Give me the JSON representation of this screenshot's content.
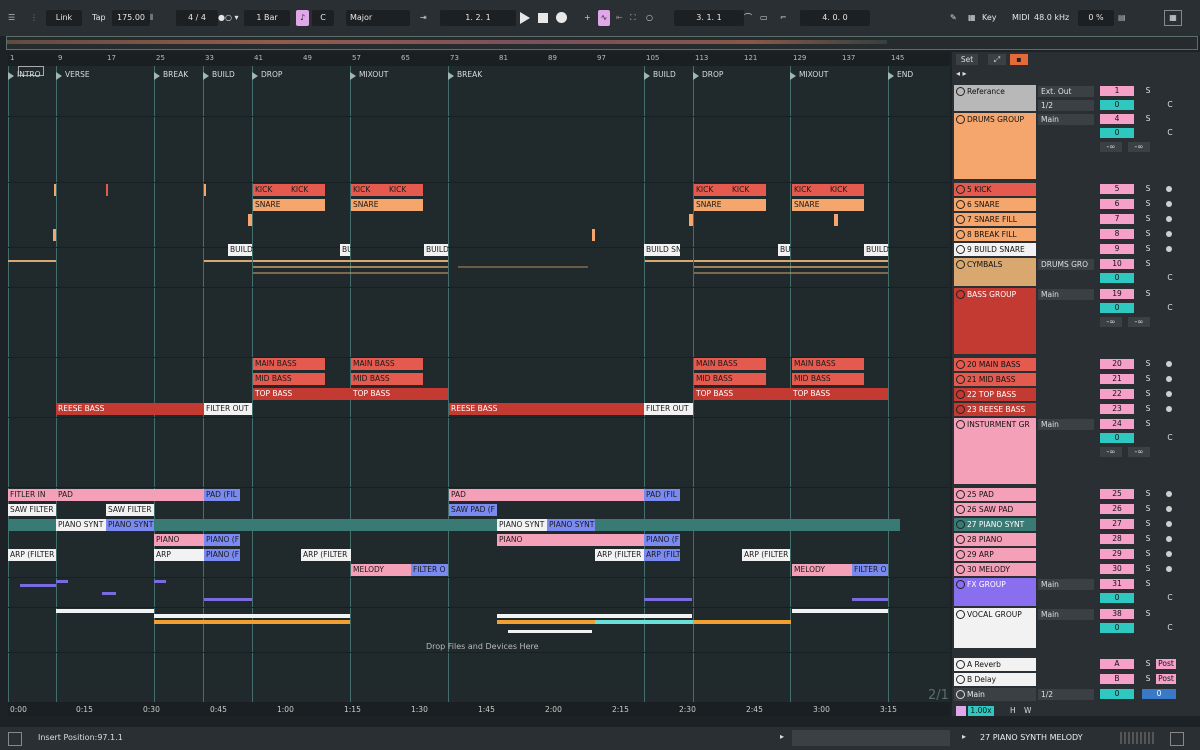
{
  "transport": {
    "link": "Link",
    "tap": "Tap",
    "tempo": "175.00",
    "signature_num": "4",
    "signature_den": "4",
    "quantize": "1 Bar",
    "key": "C",
    "scale": "Major",
    "position": "1.  2.  1",
    "loop_start": "3.  1.  1",
    "loop_length": "4.  0.  0",
    "key_label": "Key",
    "midi_label": "MIDI",
    "sample_rate": "48.0 kHz",
    "cpu": "0 %"
  },
  "locators": [
    "INTRO",
    "VERSE",
    "BREAK",
    "BUILD",
    "DROP",
    "MIXOUT",
    "BREAK",
    "BUILD",
    "DROP",
    "MIXOUT",
    "END"
  ],
  "bar_numbers": [
    "1",
    "9",
    "17",
    "25",
    "33",
    "41",
    "49",
    "57",
    "65",
    "73",
    "81",
    "89",
    "97",
    "105",
    "113",
    "121",
    "129",
    "137",
    "145"
  ],
  "times": [
    "0:00",
    "0:15",
    "0:30",
    "0:45",
    "1:00",
    "1:15",
    "1:30",
    "1:45",
    "2:00",
    "2:15",
    "2:30",
    "2:45",
    "3:00",
    "3:15"
  ],
  "clips": {
    "kick": "KICK",
    "snare": "SNARE",
    "build": "BUILD",
    "build_sn": "BUILD SN",
    "main_bass": "MAIN BASS",
    "mid_bass": "MID BASS",
    "top_bass": "TOP BASS",
    "reese_bass": "REESE BASS",
    "filter_out": "FILTER OUT",
    "filter_in": "FITLER IN",
    "pad": "PAD",
    "pad_fil": "PAD (FIL",
    "saw_filter": "SAW FILTER",
    "saw_pad": "SAW PAD (F",
    "piano_synth": "PIANO SYNT",
    "piano": "PIANO",
    "piano_f": "PIANO (F",
    "arp": "ARP",
    "arp_filter": "ARP (FILTER",
    "melody": "MELODY",
    "filter_o": "FILTER O"
  },
  "drop_hint": "Drop Files and Devices Here",
  "page_indicator": "2/1",
  "set_button": "Set",
  "tracks": [
    {
      "name": "Referance",
      "io": "Ext. Out",
      "io2": "1/2",
      "num": "1",
      "color": "#b8b8b8"
    },
    {
      "name": "DRUMS GROUP",
      "io": "Main",
      "num": "4",
      "color": "#f4a66c"
    },
    {
      "name": "5 KICK",
      "num": "5",
      "color": "#e45a4f"
    },
    {
      "name": "6 SNARE",
      "num": "6",
      "color": "#f4a66c"
    },
    {
      "name": "7 SNARE FILL",
      "num": "7",
      "color": "#f4a66c"
    },
    {
      "name": "8 BREAK FILL",
      "num": "8",
      "color": "#f4a66c"
    },
    {
      "name": "9 BUILD SNARE",
      "num": "9",
      "color": "#f2f2f2"
    },
    {
      "name": "CYMBALS",
      "io": "DRUMS GRO",
      "num": "10",
      "color": "#d8a870"
    },
    {
      "name": "BASS GROUP",
      "io": "Main",
      "num": "19",
      "color": "#c23a32"
    },
    {
      "name": "20 MAIN BASS",
      "num": "20",
      "color": "#e45a4f"
    },
    {
      "name": "21 MID BASS",
      "num": "21",
      "color": "#e45a4f"
    },
    {
      "name": "22 TOP BASS",
      "num": "22",
      "color": "#c23a32"
    },
    {
      "name": "23 REESE BASS",
      "num": "23",
      "color": "#c23a32"
    },
    {
      "name": "INSTURMENT GR",
      "io": "Main",
      "num": "24",
      "color": "#f4a0b8"
    },
    {
      "name": "25 PAD",
      "num": "25",
      "color": "#f4a0b8"
    },
    {
      "name": "26 SAW PAD",
      "num": "26",
      "color": "#f4a0b8"
    },
    {
      "name": "27 PIANO SYNT",
      "num": "27",
      "color": "#3a7a74"
    },
    {
      "name": "28 PIANO",
      "num": "28",
      "color": "#f4a0b8"
    },
    {
      "name": "29 ARP",
      "num": "29",
      "color": "#f4a0b8"
    },
    {
      "name": "30 MELODY",
      "num": "30",
      "color": "#f4a0b8"
    },
    {
      "name": "FX GROUP",
      "io": "Main",
      "num": "31",
      "color": "#8a6ef0"
    },
    {
      "name": "VOCAL GROUP",
      "io": "Main",
      "num": "38",
      "color": "#f2f2f2"
    },
    {
      "name": "A Reverb",
      "num": "A",
      "color": "#f2f2f2"
    },
    {
      "name": "B Delay",
      "num": "B",
      "color": "#f2f2f2"
    },
    {
      "name": "Main",
      "io": "1/2",
      "num": "0",
      "color": "#3a4044"
    }
  ],
  "labels": {
    "solo": "S",
    "cue": "C",
    "post": "Post",
    "neg_inf": "-∞",
    "zoom": "1.00x",
    "h": "H",
    "w": "W"
  },
  "status": {
    "insert_position": "Insert Position:97.1.1",
    "selected_clip": "27 PIANO SYNTH MELODY"
  }
}
